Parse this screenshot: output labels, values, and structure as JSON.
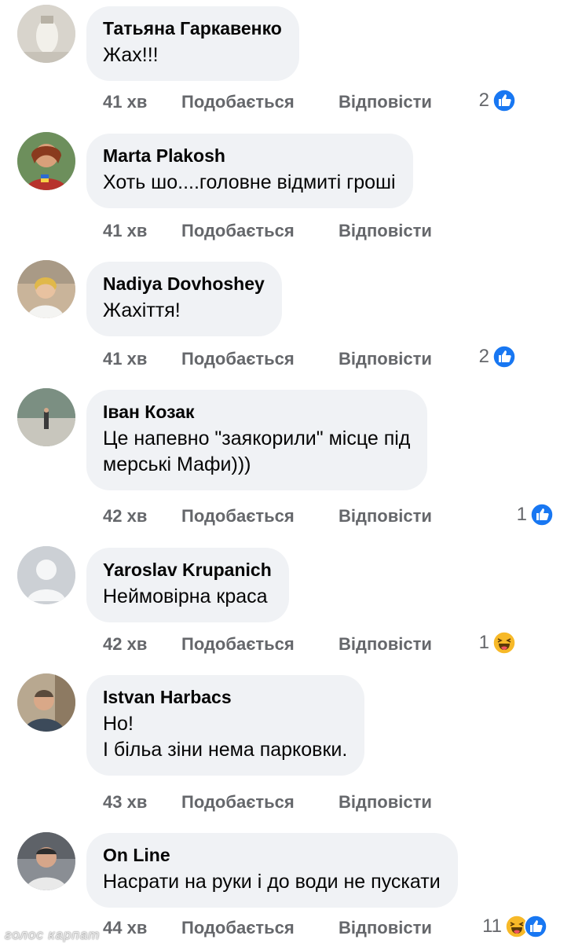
{
  "actions": {
    "like_label": "Подобається",
    "reply_label": "Відповісти"
  },
  "comments": [
    {
      "author": "Татьяна Гаркавенко",
      "text": "Жах!!!",
      "time": "41 хв",
      "reaction_count": "2",
      "reactions": [
        "like-icon"
      ]
    },
    {
      "author": "Marta Plakosh",
      "text": "Хоть шо....головне відмиті гроші",
      "time": "41 хв",
      "reaction_count": "",
      "reactions": []
    },
    {
      "author": "Nadiya Dovhoshey",
      "text": "Жахіття!",
      "time": "41 хв",
      "reaction_count": "2",
      "reactions": [
        "like-icon"
      ]
    },
    {
      "author": "Іван Козак",
      "text": "Це напевно \"заякорили\" місце під\nмерські Мафи)))",
      "time": "42 хв",
      "reaction_count": "1",
      "reactions": [
        "like-icon"
      ]
    },
    {
      "author": "Yaroslav  Krupanich",
      "text": "Неймовірна краса",
      "time": "42 хв",
      "reaction_count": "1",
      "reactions": [
        "haha-icon"
      ]
    },
    {
      "author": "Istvan Harbacs",
      "text": "Но!\nІ біль​а зіни нема парковки.",
      "time": "43 хв",
      "reaction_count": "",
      "reactions": []
    },
    {
      "author": "On Line",
      "text": "Насрати на руки і до води не пускати",
      "time": "44 хв",
      "reaction_count": "11",
      "reactions": [
        "haha-icon",
        "like-icon"
      ]
    }
  ],
  "watermark": "голос карпат",
  "colors": {
    "bubble": "#f0f2f5",
    "meta_text": "#65676b",
    "like_blue": "#1877f2",
    "haha_yellow": "#f7b928"
  }
}
